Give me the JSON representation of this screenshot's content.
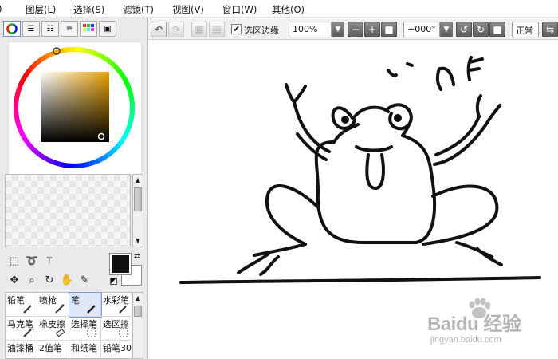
{
  "menu": {
    "items": [
      {
        "label": "文件(F)",
        "partial": ")"
      },
      {
        "label": "图层(L)"
      },
      {
        "label": "选择(S)"
      },
      {
        "label": "滤镜(T)"
      },
      {
        "label": "视图(V)"
      },
      {
        "label": "窗口(W)"
      },
      {
        "label": "其他(O)"
      }
    ]
  },
  "toolbar": {
    "selection_edge_label": "选区边缘",
    "selection_edge_checked": true,
    "zoom_value": "100%",
    "rotation_value": "+000°",
    "blend_mode": "正常"
  },
  "brush_tools": [
    {
      "name": "铅笔",
      "active": false
    },
    {
      "name": "喷枪",
      "active": false
    },
    {
      "name": "笔",
      "active": true
    },
    {
      "name": "水彩笔",
      "active": false
    },
    {
      "name": "马克笔",
      "active": false
    },
    {
      "name": "橡皮擦",
      "active": false
    },
    {
      "name": "选择笔",
      "active": false
    },
    {
      "name": "选区擦",
      "active": false
    },
    {
      "name": "油漆桶",
      "active": false
    },
    {
      "name": "2值笔",
      "active": false
    },
    {
      "name": "和纸笔",
      "active": false
    },
    {
      "name": "铅笔30",
      "active": false
    }
  ],
  "colors": {
    "foreground": "#111111",
    "background": "#ffffff",
    "hue": "#e8a000",
    "accent": "#6d8fc7"
  },
  "watermark": {
    "brand": "Baidu 经验",
    "url": "jingyan.baidu.com"
  }
}
